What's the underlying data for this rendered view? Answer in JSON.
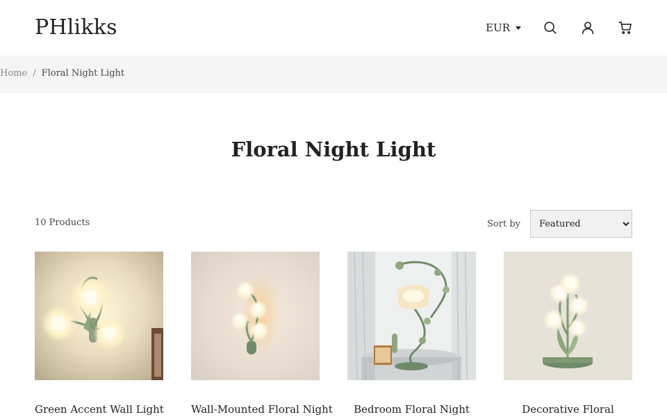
{
  "header": {
    "logo": "PHlikks",
    "currency": "EUR",
    "icons": [
      "search-icon",
      "account-icon",
      "cart-icon"
    ]
  },
  "breadcrumb": {
    "home": "Home",
    "separator": "/",
    "current": "Floral Night Light"
  },
  "collection": {
    "title": "Floral Night Light",
    "product_count": "10 Products",
    "sort_label": "Sort by",
    "sort_selected": "Featured"
  },
  "products": [
    {
      "title": "Green Accent Wall Light"
    },
    {
      "title": "Wall-Mounted Floral Night"
    },
    {
      "title": "Bedroom Floral Night"
    },
    {
      "title": "Decorative Floral"
    }
  ],
  "colors": {
    "breadcrumb_bg": "#f5f5f5",
    "text": "#222222",
    "muted": "#888888",
    "stem_green": "#7d9a72"
  }
}
